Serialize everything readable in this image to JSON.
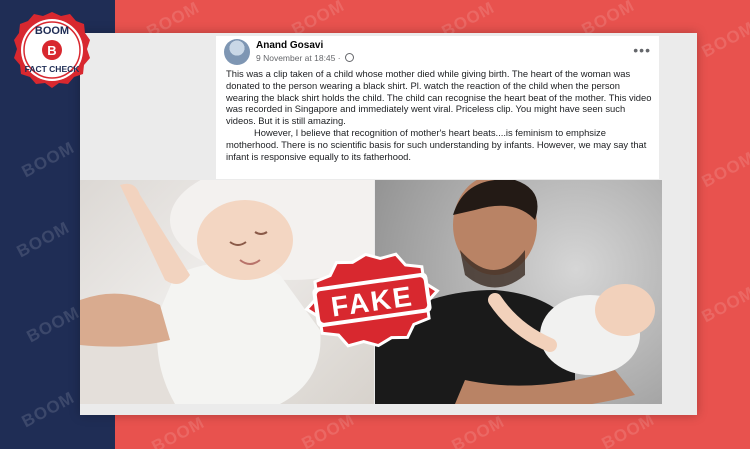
{
  "branding": {
    "logo_line1": "BOOM",
    "logo_letter": "B",
    "logo_line2": "FACT CHECK",
    "watermark": "BOOM",
    "colors": {
      "navy": "#1f2d55",
      "red": "#e8524e",
      "stamp": "#d8282f"
    }
  },
  "post": {
    "author": "Anand Gosavi",
    "timestamp": "9 November at 18:45 · ",
    "privacy_icon": "globe-icon",
    "more_icon": "more-options-icon",
    "paragraph1": "This was a clip taken of a child whose mother died while giving birth. The heart of the woman was donated to the person wearing a black shirt. Pl. watch the reaction of the child when the person wearing the black shirt holds the child. The child can recognise the heart beat of the mother. This video was recorded in Singapore and immediately went viral. Priceless clip. You might have seen such videos. But it is still amazing.",
    "paragraph2": "However, I believe that recognition of mother's heart beats....is feminism to emphsize motherhood. There is no scientific basis for such understanding by infants. However, we may say that infant is responsive equally to its fatherhood."
  },
  "stamp": {
    "label": "FAKE"
  }
}
